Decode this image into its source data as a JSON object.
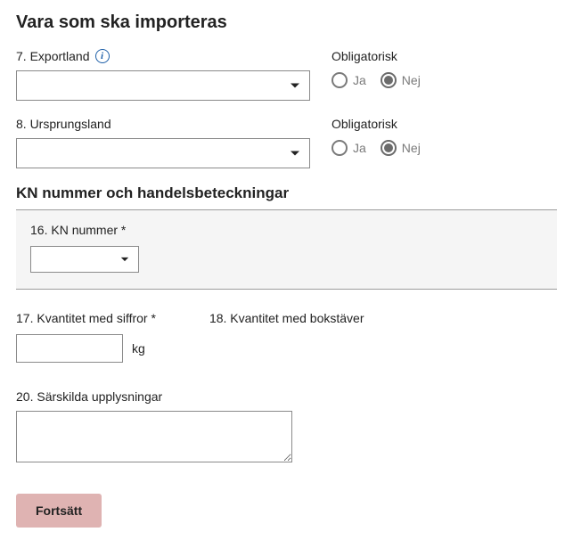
{
  "title": "Vara som ska importeras",
  "field7": {
    "label": "7. Exportland",
    "value": "",
    "obligatorisk_label": "Obligatorisk",
    "ja": "Ja",
    "nej": "Nej",
    "selected": "Nej"
  },
  "field8": {
    "label": "8. Ursprungsland",
    "value": "",
    "obligatorisk_label": "Obligatorisk",
    "ja": "Ja",
    "nej": "Nej",
    "selected": "Nej"
  },
  "kn_section": {
    "title": "KN nummer och handelsbeteckningar",
    "field16_label": "16. KN nummer *",
    "field16_value": ""
  },
  "field17": {
    "label": "17. Kvantitet med siffror *",
    "value": "",
    "unit": "kg"
  },
  "field18": {
    "label": "18. Kvantitet med bokstäver",
    "value": ""
  },
  "field20": {
    "label": "20. Särskilda upplysningar",
    "value": ""
  },
  "continue_button": "Fortsätt"
}
